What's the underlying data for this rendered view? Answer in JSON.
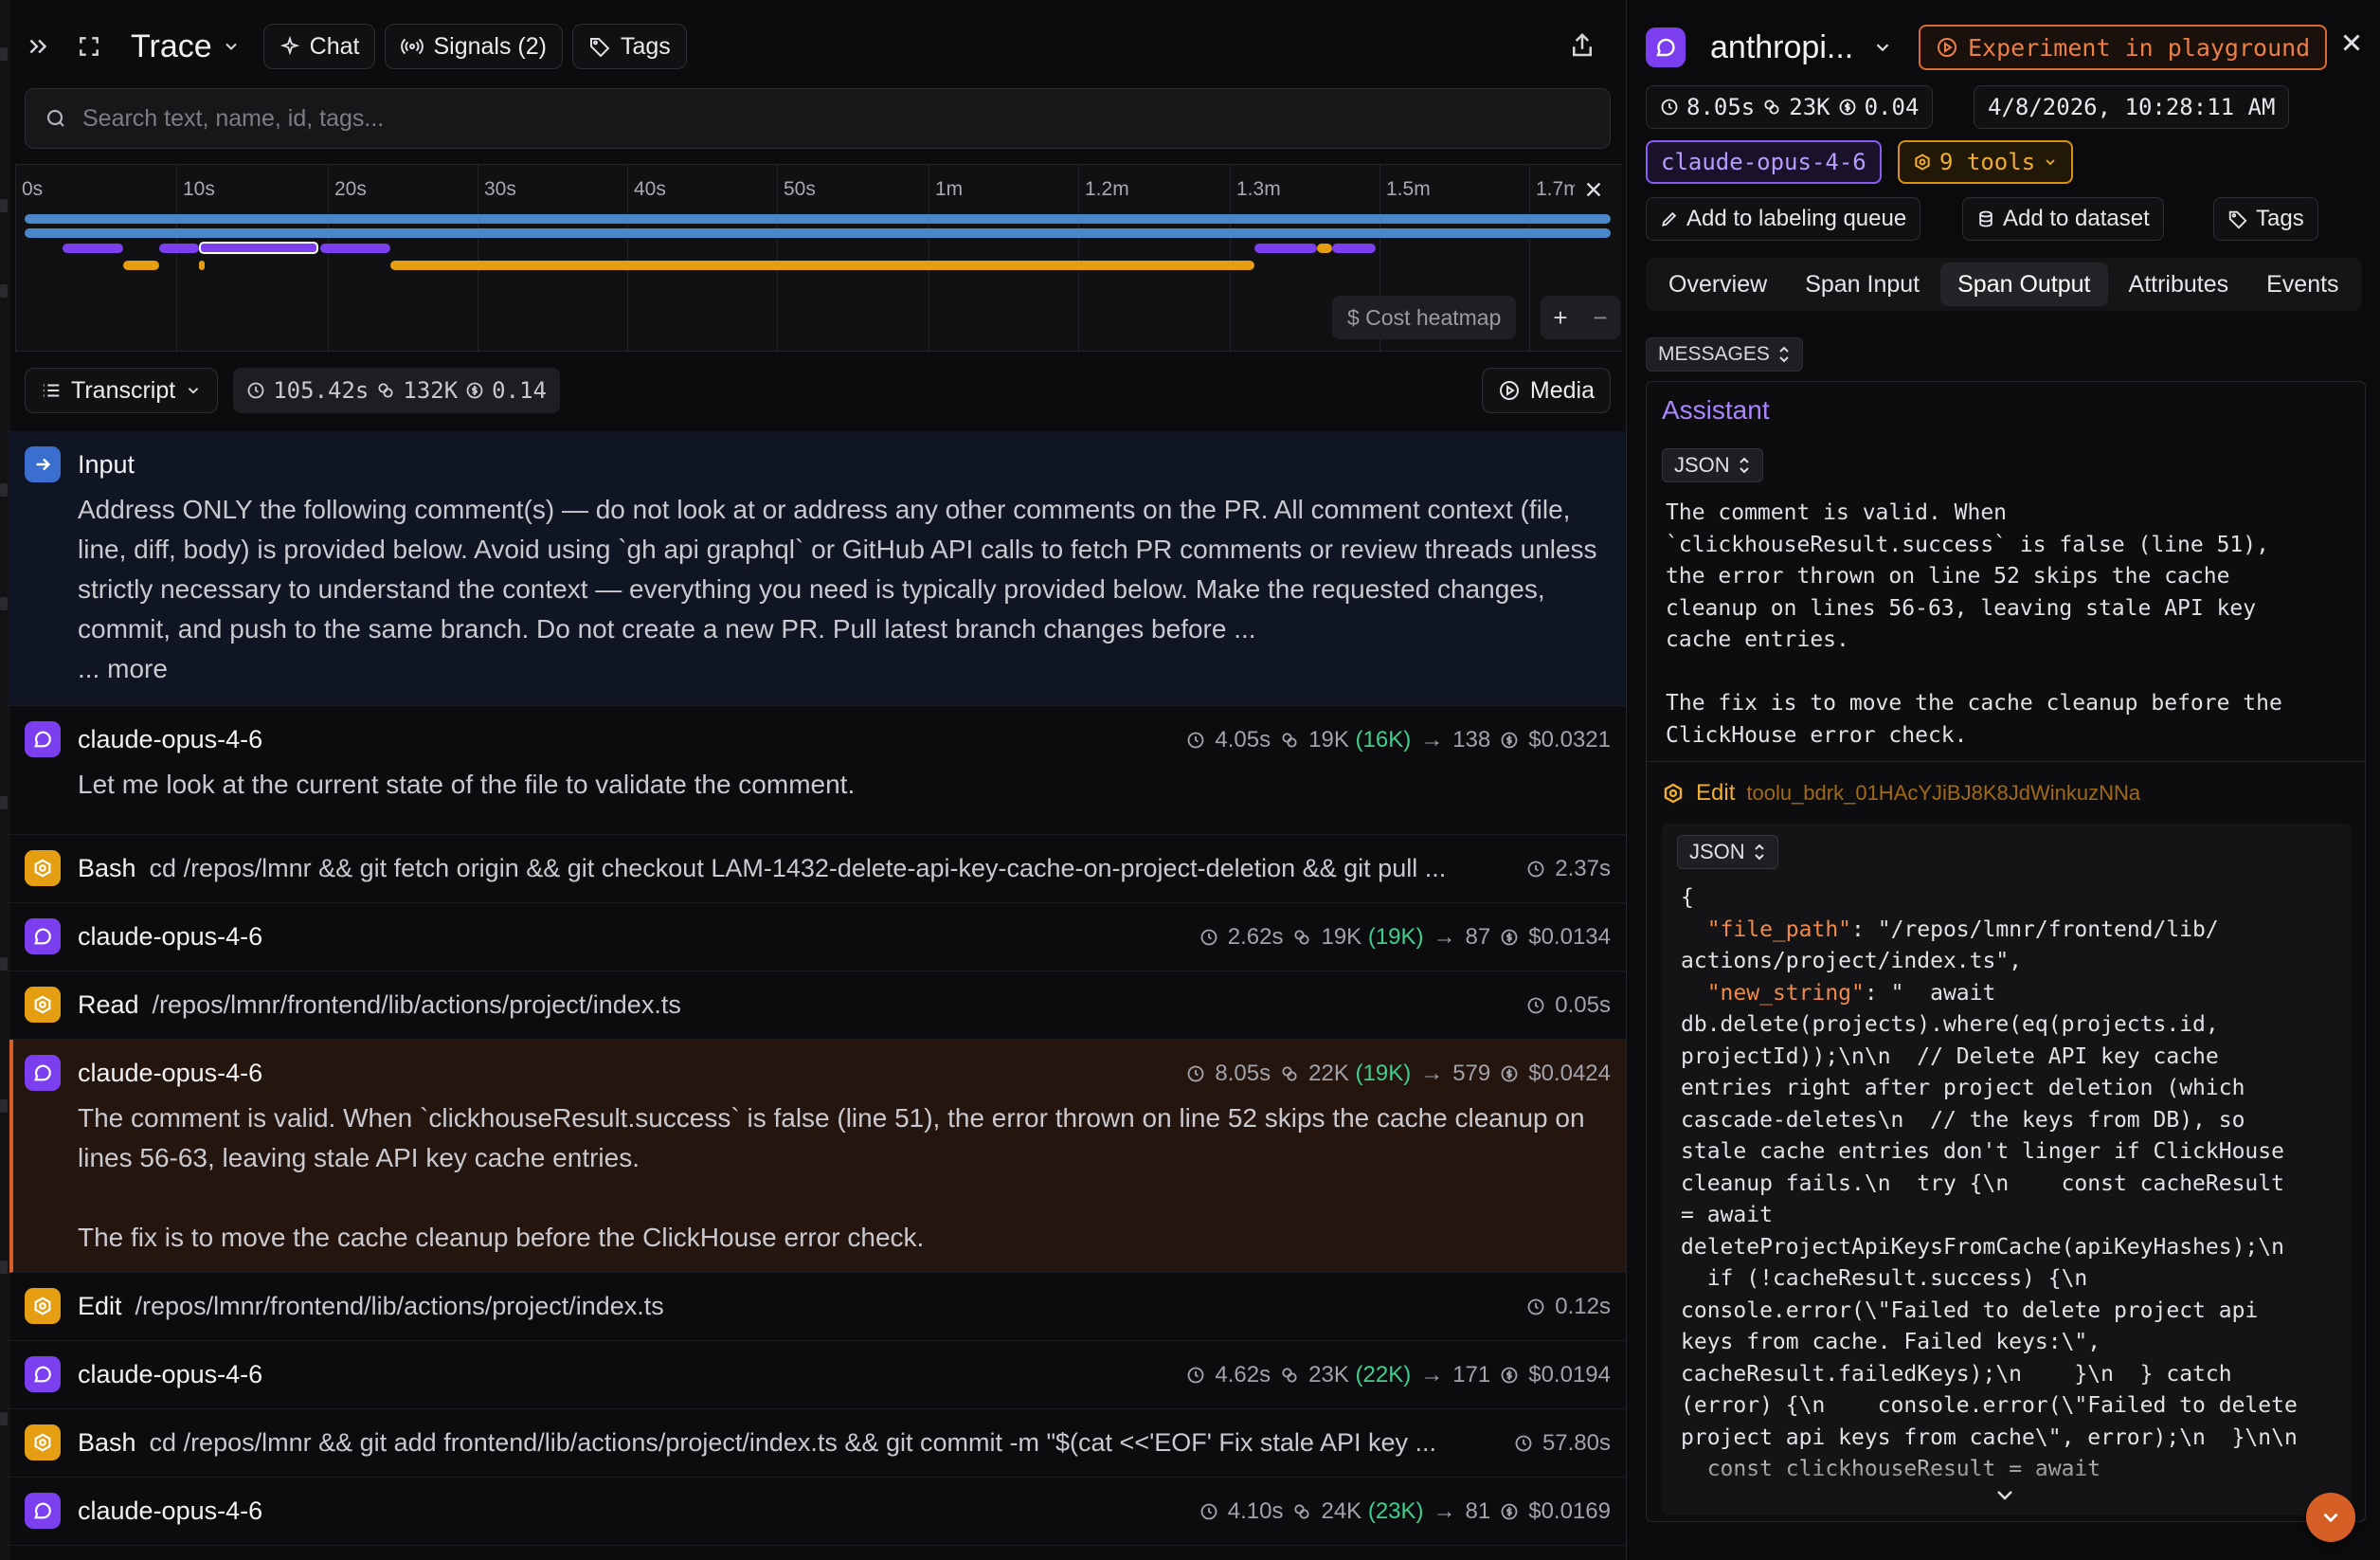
{
  "header": {
    "title": "Trace",
    "chat_label": "Chat",
    "signals_label": "Signals (2)",
    "tags_label": "Tags"
  },
  "search": {
    "placeholder": "Search text, name, id, tags..."
  },
  "timeline": {
    "ticks": [
      "0s",
      "10s",
      "20s",
      "30s",
      "40s",
      "50s",
      "1m",
      "1.2m",
      "1.3m",
      "1.5m",
      "1.7m"
    ],
    "cost_heatmap_label": "$ Cost heatmap",
    "zoom_in": "+",
    "zoom_out": "−"
  },
  "transcript_bar": {
    "view_label": "Transcript",
    "duration": "105.42s",
    "tokens": "132K",
    "cost": "0.14",
    "media_label": "Media"
  },
  "messages": [
    {
      "kind": "input",
      "name": "Input",
      "text": "Address ONLY the following comment(s) — do not look at or address any other comments on the PR. All comment context (file, line, diff, body) is provided below. Avoid using `gh api graphql` or GitHub API calls to fetch PR comments or review threads unless strictly necessary to understand the context — everything you need is typically provided below. Make the requested changes, commit, and push to the same branch. Do not create a new PR. Pull latest branch changes before ...",
      "more": "... more"
    },
    {
      "kind": "llm",
      "name": "claude-opus-4-6",
      "duration": "4.05s",
      "tokens": "19K",
      "cached": "(16K)",
      "output": "138",
      "cost": "$0.0321",
      "text": "Let me look at the current state of the file to validate the comment."
    },
    {
      "kind": "tool",
      "name": "Bash",
      "sub": "cd /repos/lmnr && git fetch origin && git checkout LAM-1432-delete-api-key-cache-on-project-deletion && git pull ...",
      "duration": "2.37s"
    },
    {
      "kind": "llm",
      "name": "claude-opus-4-6",
      "duration": "2.62s",
      "tokens": "19K",
      "cached": "(19K)",
      "output": "87",
      "cost": "$0.0134"
    },
    {
      "kind": "tool",
      "name": "Read",
      "sub": "/repos/lmnr/frontend/lib/actions/project/index.ts",
      "duration": "0.05s"
    },
    {
      "kind": "llm",
      "name": "claude-opus-4-6",
      "duration": "8.05s",
      "tokens": "22K",
      "cached": "(19K)",
      "output": "579",
      "cost": "$0.0424",
      "text": "The comment is valid. When `clickhouseResult.success` is false (line 51), the error thrown on line 52 skips the cache cleanup on lines 56-63, leaving stale API key cache entries.",
      "text2": "The fix is to move the cache cleanup before the ClickHouse error check."
    },
    {
      "kind": "tool",
      "name": "Edit",
      "sub": "/repos/lmnr/frontend/lib/actions/project/index.ts",
      "duration": "0.12s"
    },
    {
      "kind": "llm",
      "name": "claude-opus-4-6",
      "duration": "4.62s",
      "tokens": "23K",
      "cached": "(22K)",
      "output": "171",
      "cost": "$0.0194"
    },
    {
      "kind": "tool",
      "name": "Bash",
      "sub": "cd /repos/lmnr && git add frontend/lib/actions/project/index.ts && git commit -m \"$(cat <<'EOF' Fix stale API key ...",
      "duration": "57.80s"
    },
    {
      "kind": "llm",
      "name": "claude-opus-4-6",
      "duration": "4.10s",
      "tokens": "24K",
      "cached": "(23K)",
      "output": "81",
      "cost": "$0.0169"
    }
  ],
  "detail": {
    "title": "anthropi...",
    "playground_label": "Experiment in playground",
    "duration": "8.05s",
    "tokens": "23K",
    "cost": "0.04",
    "timestamp": "4/8/2026, 10:28:11 AM",
    "model": "claude-opus-4-6",
    "tools": "9 tools",
    "labeling_label": "Add to labeling queue",
    "dataset_label": "Add to dataset",
    "tags_label": "Tags",
    "tabs": [
      "Overview",
      "Span Input",
      "Span Output",
      "Attributes",
      "Events"
    ],
    "active_tab": "Span Output",
    "messages_label": "MESSAGES",
    "role": "Assistant",
    "json_label": "JSON",
    "assistant_text": "The comment is valid. When\n`clickhouseResult.success` is false (line 51),\nthe error thrown on line 52 skips the cache\ncleanup on lines 56-63, leaving stale API key\ncache entries.\n\nThe fix is to move the cache cleanup before the\nClickHouse error check.",
    "tool_call_label": "Edit",
    "tool_call_id": "toolu_bdrk_01HAcYJiBJ8K8JdWinkuzNNa",
    "code_open": "{",
    "code_key1": "\"file_path\"",
    "code_val1": ": \"/repos/lmnr/frontend/lib/\nactions/project/index.ts\",",
    "code_key2": "\"new_string\"",
    "code_val2": ": \"  await\ndb.delete(projects).where(eq(projects.id,\nprojectId));\\n\\n  // Delete API key cache\nentries right after project deletion (which\ncascade-deletes\\n  // the keys from DB), so\nstale cache entries don't linger if ClickHouse\ncleanup fails.\\n  try {\\n    const cacheResult\n= await\ndeleteProjectApiKeysFromCache(apiKeyHashes);\\n\n  if (!cacheResult.success) {\\n\nconsole.error(\\\"Failed to delete project api\nkeys from cache. Failed keys:\\\",\ncacheResult.failedKeys);\\n    }\\n  } catch\n(error) {\\n    console.error(\\\"Failed to delete\nproject api keys from cache\\\", error);\\n  }\\n\\n\n  const clickhouseResult = await"
  },
  "colors": {
    "llm": "#7b3ff0",
    "tool": "#e59e12",
    "input": "#3a6fcf",
    "cached": "#3fcf8e",
    "accent_orange": "#ec7f45",
    "timeline_blue": "#4b86c9"
  }
}
